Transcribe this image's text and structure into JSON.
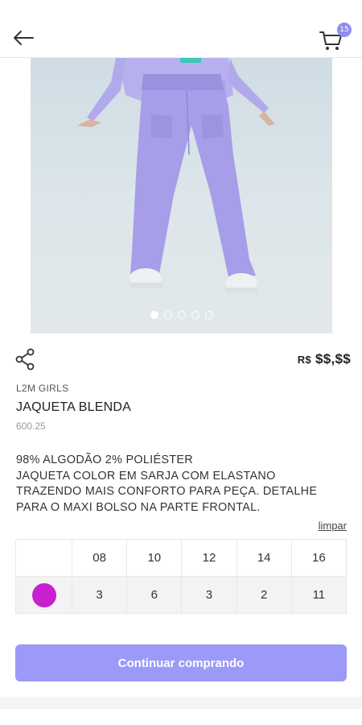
{
  "header": {
    "back_icon": "arrow-left-icon",
    "cart_icon": "shopping-cart-icon",
    "cart_count": "15",
    "accent_color": "#8f8cf2"
  },
  "gallery": {
    "image_count": 5,
    "active_index": 0
  },
  "product": {
    "share_icon": "share-icon",
    "price_currency": "R$",
    "price_value": "$$,$$",
    "brand": "L2M GIRLS",
    "name": "JAQUETA BLENDA",
    "code": "600.25",
    "description_lines": [
      "98% ALGODÃO 2% POLIÉSTER",
      "JAQUETA COLOR EM SARJA COM ELASTANO",
      "TRAZENDO MAIS CONFORTO PARA PEÇA. DETALHE",
      "PARA O MAXI BOLSO NA PARTE FRONTAL."
    ]
  },
  "size_grid": {
    "clear_label": "limpar",
    "sizes": [
      "08",
      "10",
      "12",
      "14",
      "16"
    ],
    "rows": [
      {
        "color": "#c81fd0",
        "quantities": [
          "3",
          "6",
          "3",
          "2",
          "11"
        ]
      }
    ]
  },
  "actions": {
    "continue_label": "Continuar comprando",
    "button_color": "#9c9af8"
  }
}
